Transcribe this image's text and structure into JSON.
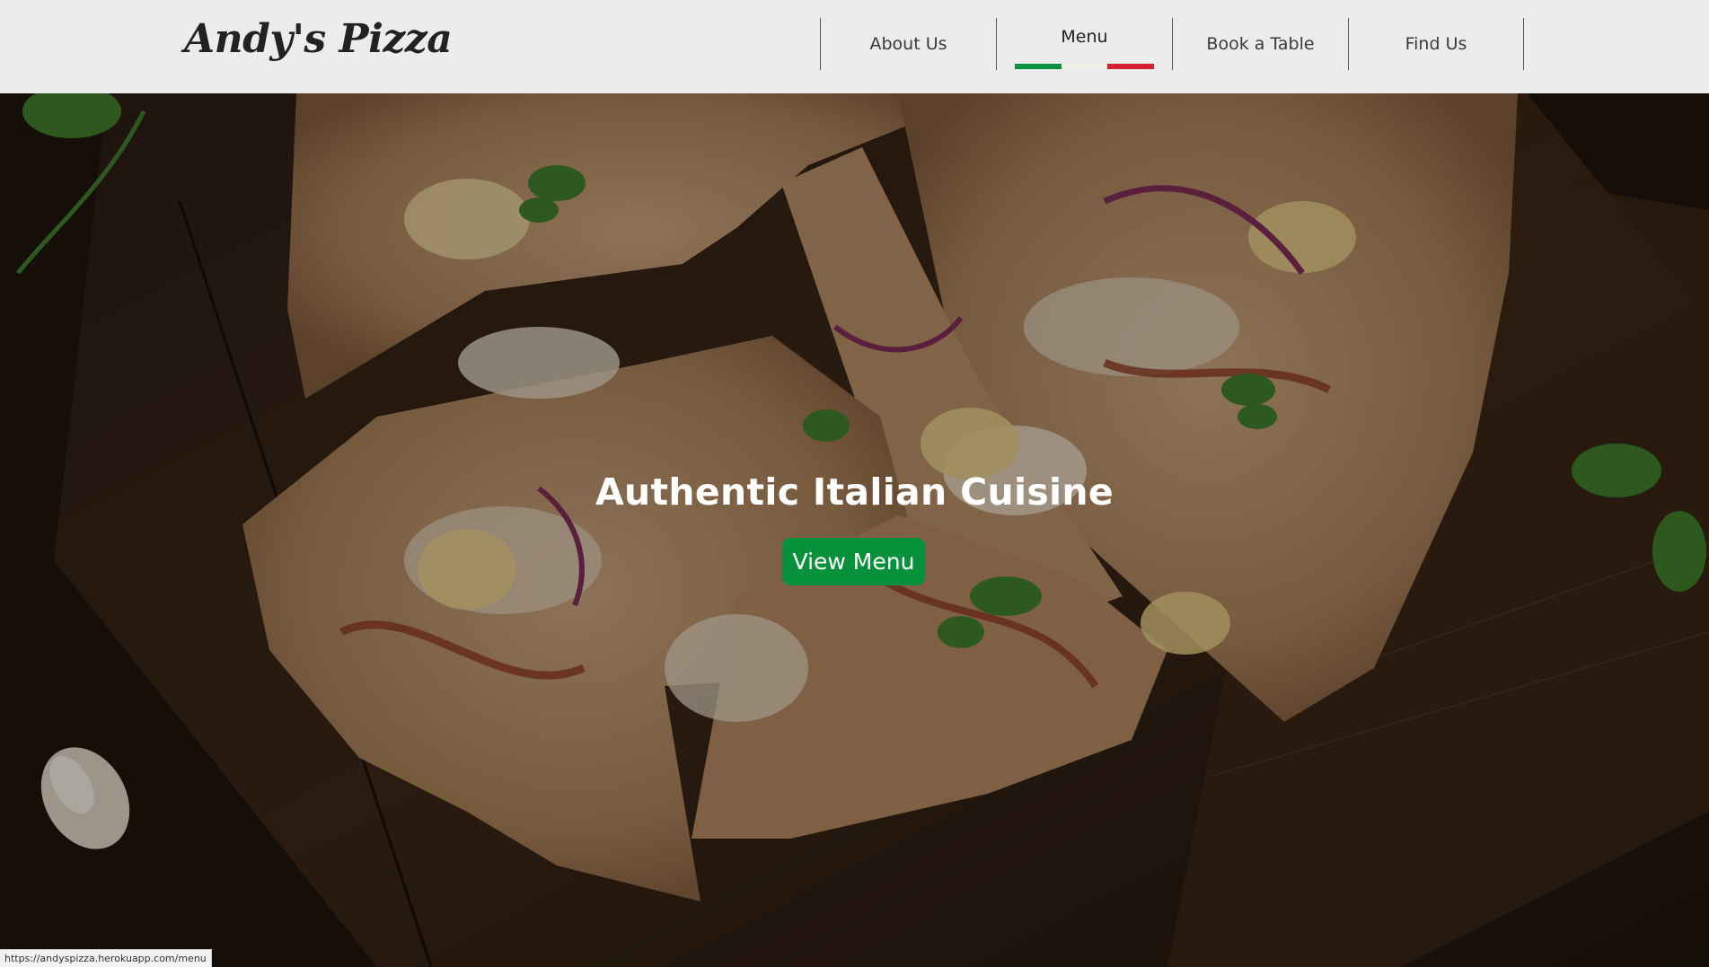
{
  "brand": {
    "name": "Andy's Pizza"
  },
  "nav": {
    "items": [
      {
        "label": "About Us"
      },
      {
        "label": "Menu",
        "active": true
      },
      {
        "label": "Book a Table"
      },
      {
        "label": "Find Us"
      }
    ],
    "flag_colors": [
      "#0a9241",
      "#f4f1e8",
      "#d32131"
    ]
  },
  "hero": {
    "title": "Authentic Italian Cuisine",
    "button_label": "View Menu",
    "button_color": "#07913a"
  },
  "status_bar": {
    "url": "https://andyspizza.herokuapp.com/menu"
  }
}
